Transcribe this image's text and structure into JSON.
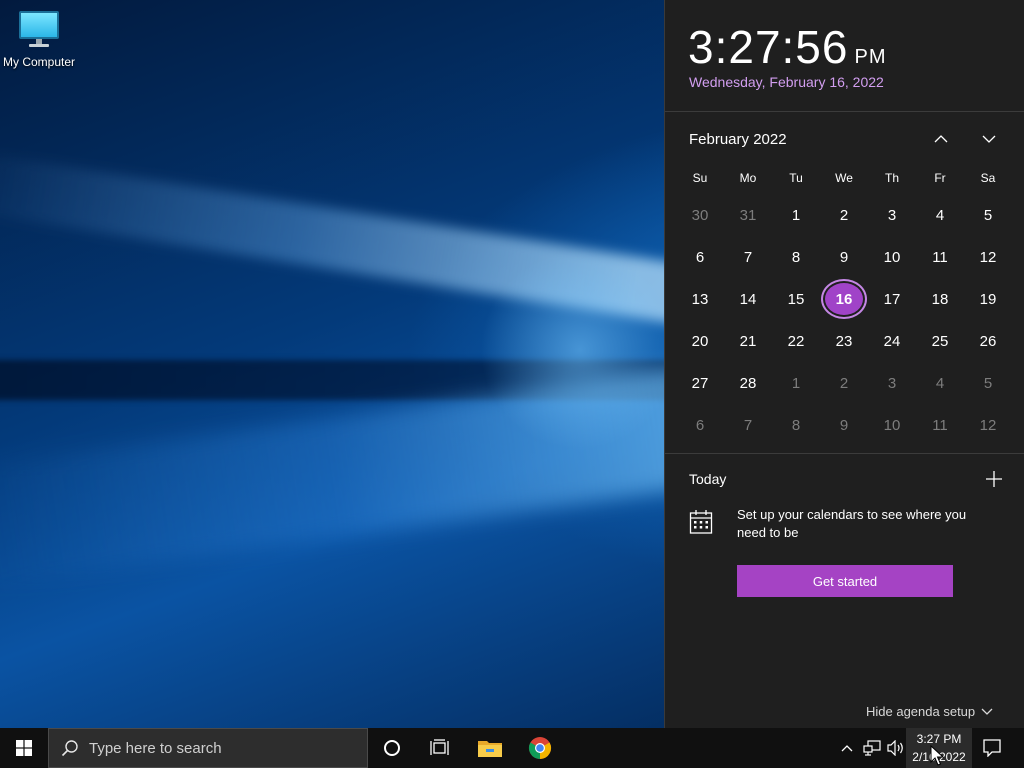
{
  "desktop": {
    "icons": [
      {
        "label": "My Computer",
        "icon": "computer-icon"
      }
    ]
  },
  "flyout": {
    "time": "3:27:56",
    "ampm": "PM",
    "date": "Wednesday, February 16, 2022",
    "month_title": "February 2022",
    "weekdays": [
      "Su",
      "Mo",
      "Tu",
      "We",
      "Th",
      "Fr",
      "Sa"
    ],
    "weeks": [
      [
        "30",
        "31",
        "1",
        "2",
        "3",
        "4",
        "5"
      ],
      [
        "6",
        "7",
        "8",
        "9",
        "10",
        "11",
        "12"
      ],
      [
        "13",
        "14",
        "15",
        "16",
        "17",
        "18",
        "19"
      ],
      [
        "20",
        "21",
        "22",
        "23",
        "24",
        "25",
        "26"
      ],
      [
        "27",
        "28",
        "1",
        "2",
        "3",
        "4",
        "5"
      ],
      [
        "6",
        "7",
        "8",
        "9",
        "10",
        "11",
        "12"
      ]
    ],
    "today_day": "16",
    "agenda": {
      "label": "Today",
      "setup_text": "Set up your calendars to see where you need to be",
      "button": "Get started",
      "hide_link": "Hide agenda setup"
    },
    "accent_color": "#a543c4",
    "date_color": "#d29ef0"
  },
  "taskbar": {
    "search_placeholder": "Type here to search",
    "pinned": [
      "windows-start-icon",
      "cortana-icon",
      "task-view-icon",
      "file-explorer-icon",
      "chrome-icon"
    ],
    "clock_time": "3:27 PM",
    "clock_date": "2/16/2022"
  }
}
